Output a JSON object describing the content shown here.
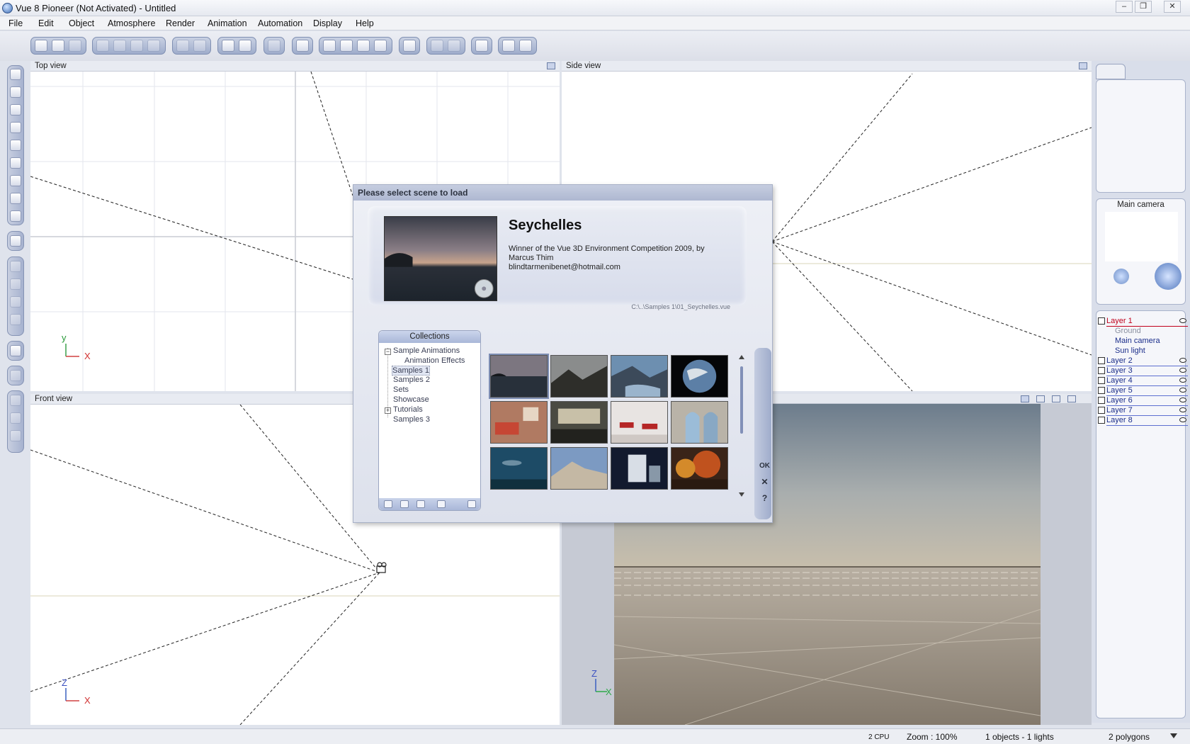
{
  "window": {
    "title": "Vue 8 Pioneer (Not Activated) - Untitled",
    "controls": [
      "–",
      "❐",
      "✕"
    ]
  },
  "menu": [
    "File",
    "Edit",
    "Object",
    "Atmosphere",
    "Render",
    "Animation",
    "Automation",
    "Display",
    "Help"
  ],
  "viewports": {
    "top": {
      "title": "Top view",
      "axis1": "y",
      "axis2": "X"
    },
    "side": {
      "title": "Side view"
    },
    "front": {
      "title": "Front view",
      "axis1": "Z",
      "axis2": "X"
    },
    "render": {
      "axis1": "Z",
      "axis2": "X"
    }
  },
  "right_panel": {
    "camera_title": "Main camera",
    "layers": [
      {
        "label": "Layer 1",
        "active": true
      },
      {
        "label": "Layer 2"
      },
      {
        "label": "Layer 3"
      },
      {
        "label": "Layer 4"
      },
      {
        "label": "Layer 5"
      },
      {
        "label": "Layer 6"
      },
      {
        "label": "Layer 7"
      },
      {
        "label": "Layer 8"
      }
    ],
    "layer1_children": [
      "Ground",
      "Main camera",
      "Sun light"
    ]
  },
  "status": {
    "cpu": "2 CPU",
    "zoom": "Zoom : 100%",
    "objects": "1 objects - 1 lights",
    "polygons": "2 polygons"
  },
  "dialog": {
    "title": "Please select scene to load",
    "scene": {
      "name": "Seychelles",
      "description": "Winner of the Vue 3D Environment Competition 2009, by Marcus Thim",
      "email": "blindtarmenibenet@hotmail.com",
      "path": "C:\\..\\Samples 1\\01_Seychelles.vue"
    },
    "collections_header": "Collections",
    "collections": [
      {
        "label": "Sample Animations",
        "expander": "−"
      },
      {
        "label": "Animation Effects"
      },
      {
        "label": "Samples 1",
        "selected": true
      },
      {
        "label": "Samples 2"
      },
      {
        "label": "Sets"
      },
      {
        "label": "Showcase"
      },
      {
        "label": "Tutorials",
        "expander": "+"
      },
      {
        "label": "Samples 3"
      }
    ],
    "buttons": {
      "ok": "OK",
      "cancel": "✕",
      "help": "?"
    }
  }
}
